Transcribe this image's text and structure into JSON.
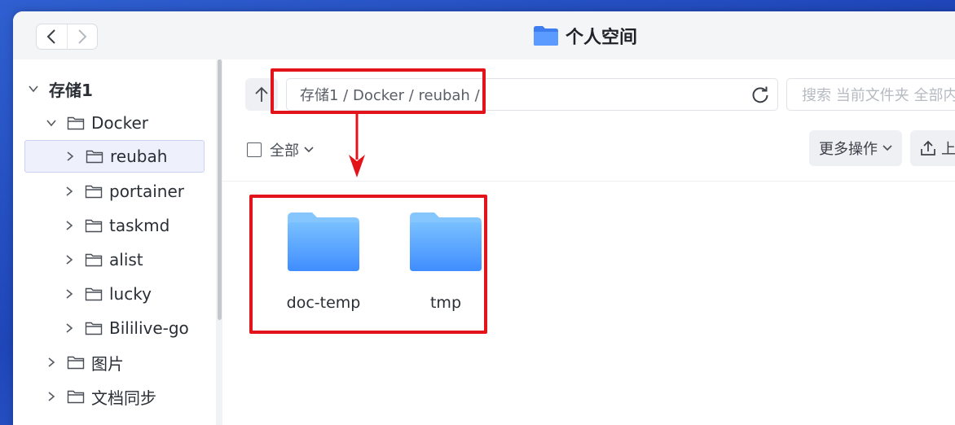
{
  "window": {
    "title": "个人空间"
  },
  "sidebar": {
    "items": [
      {
        "label": "存储1",
        "expanded": true
      },
      {
        "label": "Docker",
        "expanded": true
      },
      {
        "label": "reubah",
        "selected": true
      },
      {
        "label": "portainer"
      },
      {
        "label": "taskmd"
      },
      {
        "label": "alist"
      },
      {
        "label": "lucky"
      },
      {
        "label": "Bililive-go"
      },
      {
        "label": "图片"
      },
      {
        "label": "文档同步"
      }
    ]
  },
  "toolbar": {
    "path": "存储1 / Docker / reubah /",
    "search_placeholder": "搜索 当前文件夹 全部内容",
    "select_all_label": "全部",
    "more_actions_label": "更多操作",
    "upload_label": "上传"
  },
  "files": [
    {
      "name": "doc-temp",
      "type": "folder"
    },
    {
      "name": "tmp",
      "type": "folder"
    }
  ],
  "colors": {
    "highlight": "#e3131b",
    "folder": "#5aa9ff",
    "selected_bg": "#eef1fb"
  },
  "icons": [
    "back-icon",
    "forward-icon",
    "folder-icon",
    "chevron-down-icon",
    "chevron-right-icon",
    "up-arrow-icon",
    "refresh-icon",
    "upload-icon"
  ]
}
